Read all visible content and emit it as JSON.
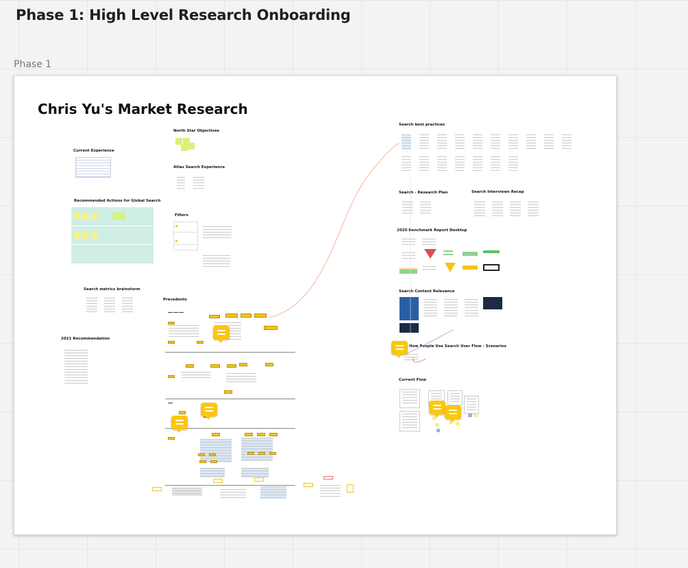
{
  "board": {
    "title": "Phase 1: High Level Research Onboarding"
  },
  "frame": {
    "label": "Phase 1",
    "title": "Chris Yu's Market Research",
    "sections": {
      "north_star": "North Star Objectives",
      "current_experience": "Current Experience",
      "atlas_search": "Atlas Search Experience",
      "recommended_actions": "Recommended Actions for Global Search",
      "filters": "Filters",
      "search_metrics": "Search metrics brainstorm",
      "precedents": "Precedents",
      "recommendation_2021": "2021 Recommendation",
      "search_best_practices": "Search best practices",
      "research_plan": "Search - Research Plan",
      "interviews_recap": "Search Interviews Recap",
      "benchmark": "2020 Benchmark Report Desktop",
      "content_relevance": "Search Content Relevance",
      "user_flow": "How People Use Search User Flow - Scenarios",
      "current_flow": "Current Flow"
    }
  },
  "comments": [
    {
      "name": "comment-precedents-1"
    },
    {
      "name": "comment-precedents-2"
    },
    {
      "name": "comment-precedents-3"
    },
    {
      "name": "comment-user-flow"
    },
    {
      "name": "comment-current-flow-1"
    },
    {
      "name": "comment-current-flow-2"
    }
  ],
  "colors": {
    "canvas": "#f3f3f3",
    "frame": "#ffffff",
    "comment": "#fac710",
    "sticky": "#f6f18a",
    "panel": "#cfeee6",
    "connector": "#f4a48a"
  },
  "icons": [
    "comment-icon"
  ]
}
